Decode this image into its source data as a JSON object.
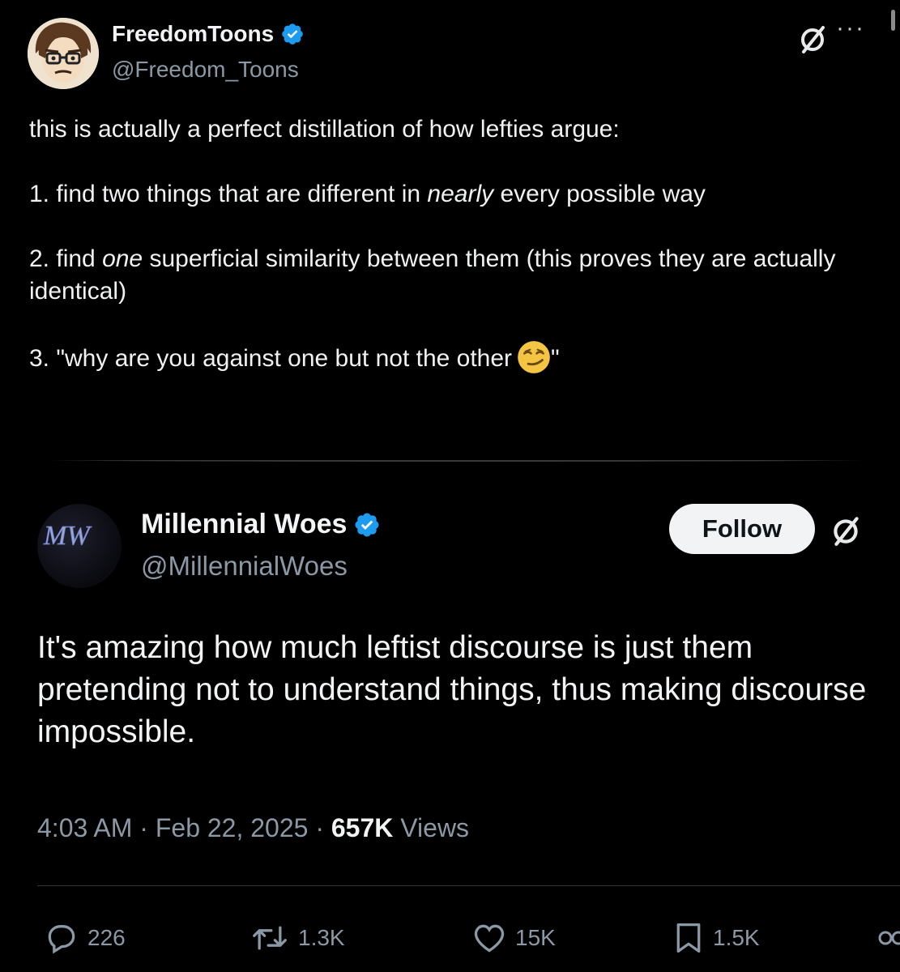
{
  "quoted_post": {
    "display_name": "FreedomToons",
    "handle": "@Freedom_Toons",
    "more_label": "···",
    "intro": "this is actually a perfect distillation of how lefties argue:",
    "point1_before": "1. find two things that are different in ",
    "point1_em": "nearly",
    "point1_after": " every possible way",
    "point2_before": "2. find ",
    "point2_em": "one",
    "point2_after": " superficial similarity between them (this proves they are actually identical)",
    "point3_before": "3. \"why are you against one but not the other",
    "point3_after": "\""
  },
  "main_post": {
    "display_name": "Millennial Woes",
    "handle": "@MillennialWoes",
    "avatar_monogram": "MW",
    "follow_label": "Follow",
    "text": "It's amazing how much leftist discourse is just them pretending not to understand things, thus making discourse impossible.",
    "time": "4:03 AM",
    "date": "Feb 22, 2025",
    "separator": "·",
    "views_count": "657K",
    "views_label": "Views"
  },
  "actions": {
    "replies": "226",
    "reposts": "1.3K",
    "likes": "15K",
    "bookmarks": "1.5K"
  },
  "colors": {
    "background": "#000000",
    "verified_blue": "#1d9bf0",
    "muted_text": "#8b98a5"
  }
}
